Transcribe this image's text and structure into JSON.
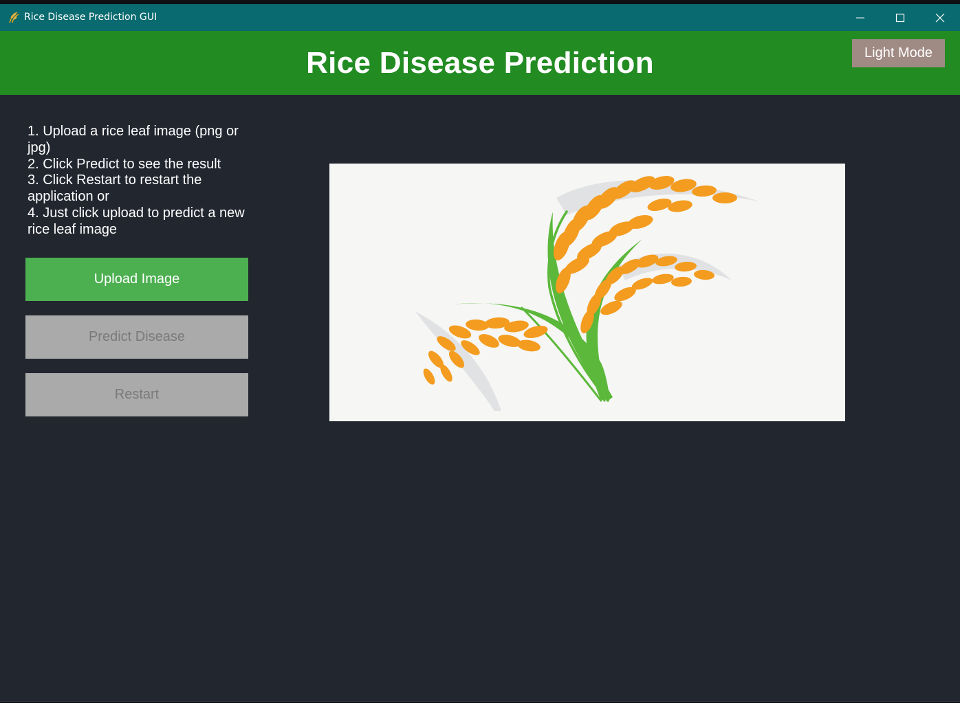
{
  "window": {
    "title": "Rice Disease Prediction GUI",
    "app_icon": "rice-icon",
    "controls": [
      "minimize-icon",
      "maximize-icon",
      "close-icon"
    ]
  },
  "header": {
    "title": "Rice Disease Prediction",
    "light_mode_label": "Light Mode"
  },
  "instructions": [
    "1. Upload a rice leaf image (png or jpg)",
    "2. Click Predict to see the result",
    "3. Click Restart to restart the application or",
    "4. Just click upload to predict a new rice leaf image"
  ],
  "buttons": {
    "upload": "Upload Image",
    "predict": "Predict Disease",
    "restart": "Restart"
  },
  "image_panel": {
    "image": "rice-plant-illustration"
  },
  "colors": {
    "titlebar": "#096a6f",
    "header": "#228b22",
    "background": "#22262f",
    "upload_button": "#4caf50",
    "disabled_button": "#aaaaaa",
    "light_mode_button": "#a08a84",
    "grain": "#f39c1f",
    "stem": "#5cb83a"
  }
}
